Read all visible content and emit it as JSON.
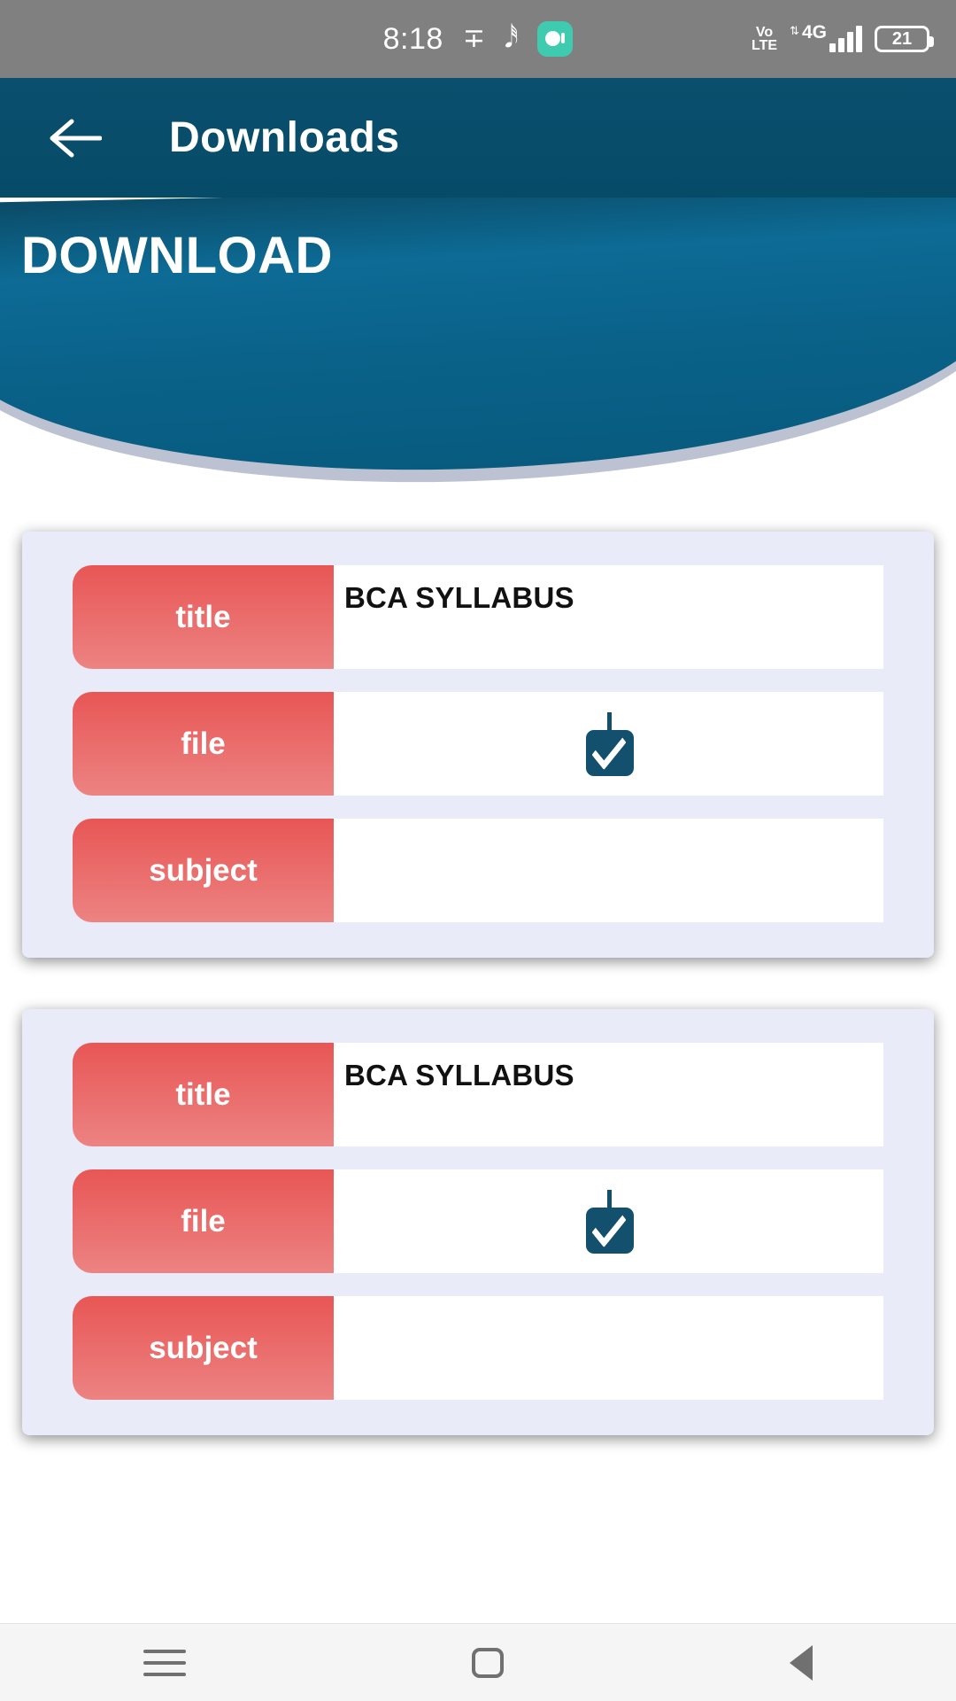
{
  "status_bar": {
    "time": "8:18",
    "notification_icons": [
      "m-app-icon",
      "m-app-icon-2",
      "teal-app-icon"
    ],
    "volte_label": "Vo\nLTE",
    "volte_top": "Vo",
    "volte_bottom": "LTE",
    "network_type": "4G",
    "data_arrows": "⇅",
    "signal_bars": 4,
    "battery_percent": "21"
  },
  "app_bar": {
    "back_icon": "arrow-left-icon",
    "title": "Downloads"
  },
  "banner": {
    "heading": "DOWNLOAD",
    "gradient_top": "#0b4a66",
    "gradient_mid": "#0d6b95",
    "gradient_bottom": "#075a7d",
    "shadow_color": "#bcc2d1"
  },
  "theme": {
    "accent_red": "#e85655",
    "accent_red_light": "#ec8382",
    "accent_blue": "#12506e",
    "card_bg": "#e9ecf8",
    "status_bar_bg": "#808080"
  },
  "cards": [
    {
      "rows": [
        {
          "label": "title",
          "value": "BCA SYLLABUS",
          "type": "text"
        },
        {
          "label": "file",
          "value": "",
          "type": "download"
        },
        {
          "label": "subject",
          "value": "",
          "type": "text"
        }
      ]
    },
    {
      "rows": [
        {
          "label": "title",
          "value": "BCA SYLLABUS",
          "type": "text"
        },
        {
          "label": "file",
          "value": "",
          "type": "download"
        },
        {
          "label": "subject",
          "value": "",
          "type": "text"
        }
      ]
    }
  ],
  "nav_bar": {
    "recents_icon": "hamburger-icon",
    "home_icon": "square-icon",
    "back_icon": "triangle-back-icon"
  }
}
